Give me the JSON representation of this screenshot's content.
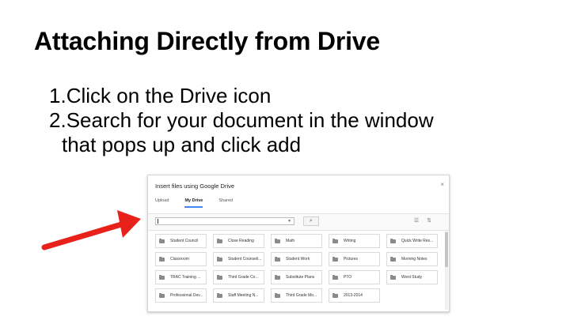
{
  "slide": {
    "title": "Attaching Directly from Drive",
    "steps": [
      {
        "number": "1.",
        "text": "Click on the Drive icon"
      },
      {
        "number": "2.",
        "text": "Search for your document in the window",
        "continuation": "that pops up and click add"
      }
    ]
  },
  "dialog": {
    "title": "Insert files using Google Drive",
    "close_label": "×",
    "tabs": [
      {
        "label": "Upload",
        "active": false
      },
      {
        "label": "My Drive",
        "active": true
      },
      {
        "label": "Shared",
        "active": false
      }
    ],
    "search": {
      "value": ""
    },
    "folders": [
      "Student Council",
      "Close Reading",
      "Math",
      "Writing",
      "Quick Write Res...",
      "Classroom",
      "Student Counseli...",
      "Student Work",
      "Pictures",
      "Morning Notes",
      "TRAC Training ...",
      "Third Grade Co...",
      "Substitute Plans",
      "PTO",
      "Word Study",
      "Professional Dev...",
      "Staff Meeting N...",
      "Third Grade Mo...",
      "2013-2014"
    ]
  },
  "colors": {
    "arrow": "#e8221b",
    "tab_underline": "#4285f4",
    "folder_icon": "#8a8a8a"
  },
  "icons": {
    "search": "magnifier-icon",
    "close": "close-icon",
    "list_view": "list-view-icon",
    "sort": "sort-icon",
    "folder": "folder-icon"
  }
}
